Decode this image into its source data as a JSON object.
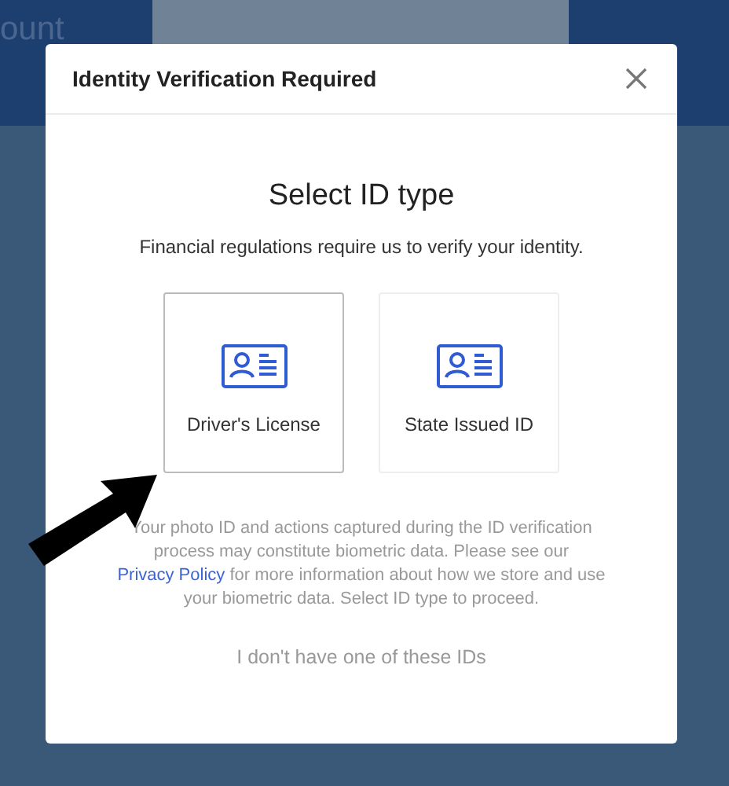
{
  "background": {
    "heading": "ount"
  },
  "dialog": {
    "title": "Identity Verification Required",
    "heading": "Select ID type",
    "subtitle": "Financial regulations require us to verify your identity.",
    "options": [
      {
        "label": "Driver's License",
        "selected": true
      },
      {
        "label": "State Issued ID",
        "selected": false
      }
    ],
    "notice": {
      "before": "Your photo ID and actions captured during the ID verification process may constitute biometric data. Please see our",
      "link": "Privacy Policy",
      "after": "for more information about how we store and use your biometric data. Select ID type to proceed."
    },
    "alternative": "I don't have one of these IDs"
  }
}
